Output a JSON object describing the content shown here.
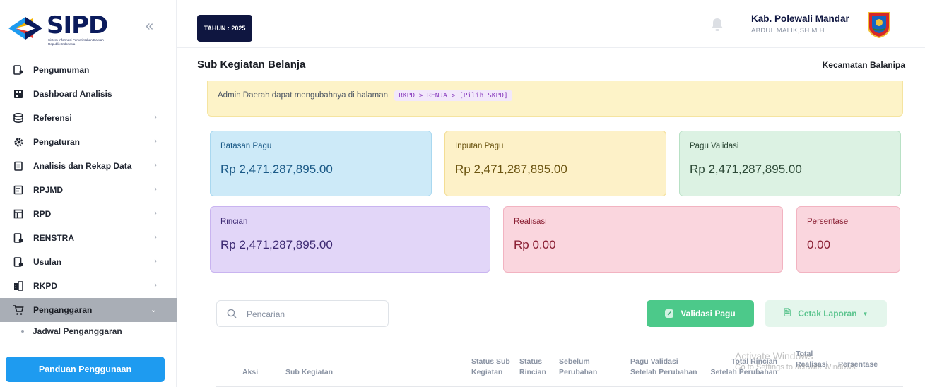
{
  "app": {
    "logo_text": "SIPD",
    "logo_subtitle": "Sistem Informasi Pemerintahan Daerah Republik Indonesia",
    "collapse_glyph": "«"
  },
  "sidebar": {
    "items": [
      {
        "label": "Pengumuman",
        "icon": "announcement-icon",
        "chevron": ""
      },
      {
        "label": "Dashboard Analisis",
        "icon": "dashboard-icon",
        "chevron": ""
      },
      {
        "label": "Referensi",
        "icon": "database-icon",
        "chevron": "›"
      },
      {
        "label": "Pengaturan",
        "icon": "gear-icon",
        "chevron": "›"
      },
      {
        "label": "Analisis dan Rekap Data",
        "icon": "clipboard-icon",
        "chevron": "›"
      },
      {
        "label": "RPJMD",
        "icon": "document-icon",
        "chevron": "›"
      },
      {
        "label": "RPD",
        "icon": "table-icon",
        "chevron": "›"
      },
      {
        "label": "RENSTRA",
        "icon": "file-gear-icon",
        "chevron": "›"
      },
      {
        "label": "Usulan",
        "icon": "file-edit-icon",
        "chevron": "›"
      },
      {
        "label": "RKPD",
        "icon": "building-icon",
        "chevron": "›"
      },
      {
        "label": "Penganggaran",
        "icon": "cart-icon",
        "chevron": "⌄"
      }
    ],
    "active_index": 10,
    "submenu_item": "Jadwal Penganggaran",
    "guide_button": "Panduan Penggunaan"
  },
  "topbar": {
    "year_badge": "TAHUN : 2025",
    "region": "Kab. Polewali Mandar",
    "user": "ABDUL MALIK,SH.M.H"
  },
  "page": {
    "title": "Sub Kegiatan Belanja",
    "org": "Kecamatan Balanipa"
  },
  "notice": {
    "text": "Admin Daerah dapat mengubahnya di halaman",
    "code": "RKPD > RENJA > [Pilih SKPD]"
  },
  "cards": {
    "batasan_pagu": {
      "label": "Batasan Pagu",
      "value": "Rp 2,471,287,895.00"
    },
    "inputan_pagu": {
      "label": "Inputan Pagu",
      "value": "Rp 2,471,287,895.00"
    },
    "pagu_validasi": {
      "label": "Pagu Validasi",
      "value": "Rp 2,471,287,895.00"
    },
    "rincian": {
      "label": "Rincian",
      "value": "Rp 2,471,287,895.00"
    },
    "realisasi": {
      "label": "Realisasi",
      "value": "Rp 0.00"
    },
    "persentase": {
      "label": "Persentase",
      "value": "0.00"
    }
  },
  "toolbar": {
    "search_placeholder": "Pencarian",
    "validasi_label": "Validasi Pagu",
    "cetak_label": "Cetak Laporan"
  },
  "table": {
    "headers": {
      "aksi": "Aksi",
      "sub_kegiatan": "Sub Kegiatan",
      "status_sub_1": "Status Sub",
      "status_sub_2": "Kegiatan",
      "status_rincian_1": "Status",
      "status_rincian_2": "Rincian",
      "sebelum_1": "Sebelum",
      "sebelum_2": "Perubahan",
      "pagu_validasi_1": "Pagu Validasi",
      "pagu_validasi_2": "Setelah Perubahan",
      "total_rincian_1": "Total Rincian",
      "total_rincian_2": "Setelah Perubahan",
      "total_realisasi_1": "Total",
      "total_realisasi_2": "Realisasi",
      "persentase": "Persentase"
    }
  },
  "watermark": {
    "line1": "Activate Windows",
    "line2": "Go to Settings to activate Windows."
  },
  "colors": {
    "sidebar_active": "#a9aeb6",
    "primary_blue": "#1e9bf0",
    "success_green": "#4cc98a",
    "navy": "#0f1640"
  }
}
